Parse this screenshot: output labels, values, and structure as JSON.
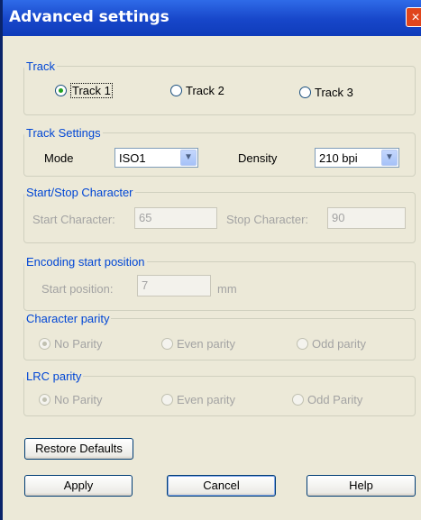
{
  "window": {
    "title": "Advanced settings",
    "close_label": "×"
  },
  "track": {
    "legend": "Track",
    "options": [
      "Track 1",
      "Track 2",
      "Track 3"
    ],
    "selected": "Track 1"
  },
  "track_settings": {
    "legend": "Track Settings",
    "mode_label": "Mode",
    "mode_value": "ISO1",
    "density_label": "Density",
    "density_value": "210 bpi",
    "dropdown_arrow": "▼"
  },
  "start_stop": {
    "legend": "Start/Stop Character",
    "start_label": "Start Character:",
    "start_value": "65",
    "stop_label": "Stop Character:",
    "stop_value": "90"
  },
  "encoding": {
    "legend": "Encoding start position",
    "label": "Start position:",
    "value": "7",
    "unit": "mm"
  },
  "char_parity": {
    "legend": "Character parity",
    "options": [
      "No Parity",
      "Even parity",
      "Odd parity"
    ],
    "selected": "No Parity"
  },
  "lrc_parity": {
    "legend": "LRC parity",
    "options": [
      "No Parity",
      "Even parity",
      "Odd Parity"
    ],
    "selected": "No Parity"
  },
  "buttons": {
    "restore": "Restore Defaults",
    "apply": "Apply",
    "cancel": "Cancel",
    "help": "Help"
  }
}
